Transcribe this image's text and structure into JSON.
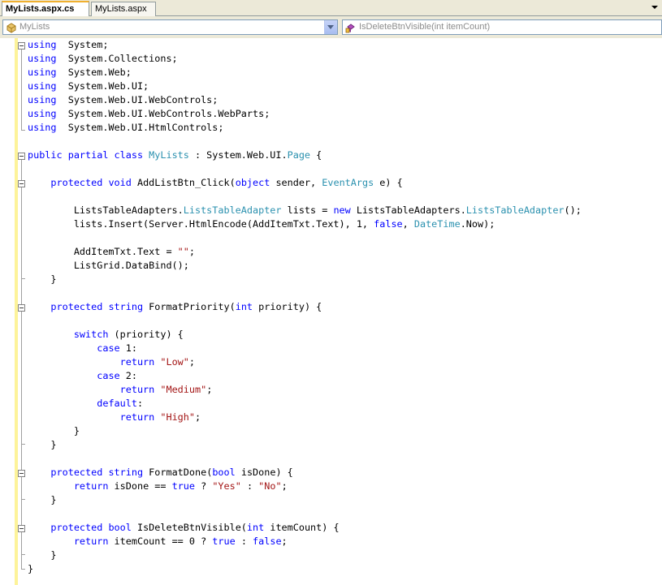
{
  "tabs": [
    {
      "label": "MyLists.aspx.cs",
      "active": true
    },
    {
      "label": "MyLists.aspx",
      "active": false
    }
  ],
  "nav": {
    "class_combo": "MyLists",
    "member_combo": "IsDeleteBtnVisible(int itemCount)"
  },
  "colors": {
    "keyword": "#0000ff",
    "type": "#2b91af",
    "string": "#a31515",
    "text": "#000000",
    "change_bar": "#fdf39a"
  },
  "code_lines": [
    [
      [
        "kw",
        "using"
      ],
      [
        "",
        "  System;"
      ]
    ],
    [
      [
        "kw",
        "using"
      ],
      [
        "",
        "  System.Collections;"
      ]
    ],
    [
      [
        "kw",
        "using"
      ],
      [
        "",
        "  System.Web;"
      ]
    ],
    [
      [
        "kw",
        "using"
      ],
      [
        "",
        "  System.Web.UI;"
      ]
    ],
    [
      [
        "kw",
        "using"
      ],
      [
        "",
        "  System.Web.UI.WebControls;"
      ]
    ],
    [
      [
        "kw",
        "using"
      ],
      [
        "",
        "  System.Web.UI.WebControls.WebParts;"
      ]
    ],
    [
      [
        "kw",
        "using"
      ],
      [
        "",
        "  System.Web.UI.HtmlControls;"
      ]
    ],
    [],
    [
      [
        "kw",
        "public partial class "
      ],
      [
        "ty",
        "MyLists"
      ],
      [
        "",
        " : System.Web.UI."
      ],
      [
        "ty",
        "Page"
      ],
      [
        "",
        " {"
      ]
    ],
    [],
    [
      [
        "",
        "    "
      ],
      [
        "kw",
        "protected void "
      ],
      [
        "",
        "AddListBtn_Click("
      ],
      [
        "kw",
        "object"
      ],
      [
        "",
        " sender, "
      ],
      [
        "ty",
        "EventArgs"
      ],
      [
        "",
        " e) {"
      ]
    ],
    [],
    [
      [
        "",
        "        ListsTableAdapters."
      ],
      [
        "ty",
        "ListsTableAdapter"
      ],
      [
        "",
        " lists = "
      ],
      [
        "kw",
        "new"
      ],
      [
        "",
        " ListsTableAdapters."
      ],
      [
        "ty",
        "ListsTableAdapter"
      ],
      [
        "",
        "();"
      ]
    ],
    [
      [
        "",
        "        lists.Insert(Server.HtmlEncode(AddItemTxt.Text), 1, "
      ],
      [
        "kw",
        "false"
      ],
      [
        "",
        ", "
      ],
      [
        "ty",
        "DateTime"
      ],
      [
        "",
        ".Now);"
      ]
    ],
    [],
    [
      [
        "",
        "        AddItemTxt.Text = "
      ],
      [
        "st",
        "\"\""
      ],
      [
        "",
        ";"
      ]
    ],
    [
      [
        "",
        "        ListGrid.DataBind();"
      ]
    ],
    [
      [
        "",
        "    }"
      ]
    ],
    [],
    [
      [
        "",
        "    "
      ],
      [
        "kw",
        "protected string "
      ],
      [
        "",
        "FormatPriority("
      ],
      [
        "kw",
        "int"
      ],
      [
        "",
        " priority) {"
      ]
    ],
    [],
    [
      [
        "",
        "        "
      ],
      [
        "kw",
        "switch"
      ],
      [
        "",
        " (priority) {"
      ]
    ],
    [
      [
        "",
        "            "
      ],
      [
        "kw",
        "case"
      ],
      [
        "",
        " 1:"
      ]
    ],
    [
      [
        "",
        "                "
      ],
      [
        "kw",
        "return "
      ],
      [
        "st",
        "\"Low\""
      ],
      [
        "",
        ";"
      ]
    ],
    [
      [
        "",
        "            "
      ],
      [
        "kw",
        "case"
      ],
      [
        "",
        " 2:"
      ]
    ],
    [
      [
        "",
        "                "
      ],
      [
        "kw",
        "return "
      ],
      [
        "st",
        "\"Medium\""
      ],
      [
        "",
        ";"
      ]
    ],
    [
      [
        "",
        "            "
      ],
      [
        "kw",
        "default"
      ],
      [
        "",
        ":"
      ]
    ],
    [
      [
        "",
        "                "
      ],
      [
        "kw",
        "return "
      ],
      [
        "st",
        "\"High\""
      ],
      [
        "",
        ";"
      ]
    ],
    [
      [
        "",
        "        }"
      ]
    ],
    [
      [
        "",
        "    }"
      ]
    ],
    [],
    [
      [
        "",
        "    "
      ],
      [
        "kw",
        "protected string "
      ],
      [
        "",
        "FormatDone("
      ],
      [
        "kw",
        "bool"
      ],
      [
        "",
        " isDone) {"
      ]
    ],
    [
      [
        "",
        "        "
      ],
      [
        "kw",
        "return"
      ],
      [
        "",
        " isDone == "
      ],
      [
        "kw",
        "true"
      ],
      [
        "",
        " ? "
      ],
      [
        "st",
        "\"Yes\""
      ],
      [
        "",
        " : "
      ],
      [
        "st",
        "\"No\""
      ],
      [
        "",
        ";"
      ]
    ],
    [
      [
        "",
        "    }"
      ]
    ],
    [],
    [
      [
        "",
        "    "
      ],
      [
        "kw",
        "protected bool "
      ],
      [
        "",
        "IsDeleteBtnVisible("
      ],
      [
        "kw",
        "int"
      ],
      [
        "",
        " itemCount) {"
      ]
    ],
    [
      [
        "",
        "        "
      ],
      [
        "kw",
        "return"
      ],
      [
        "",
        " itemCount == 0 ? "
      ],
      [
        "kw",
        "true"
      ],
      [
        "",
        " : "
      ],
      [
        "kw",
        "false"
      ],
      [
        "",
        ";"
      ]
    ],
    [
      [
        "",
        "    }"
      ]
    ],
    [
      [
        "",
        "}"
      ]
    ]
  ]
}
